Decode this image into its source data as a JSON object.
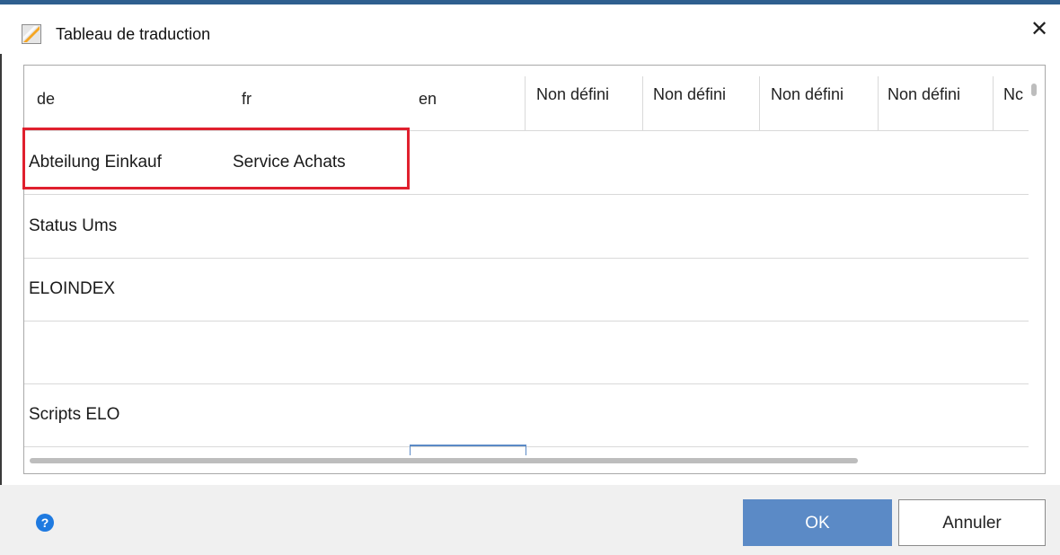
{
  "window": {
    "title": "Tableau de traduction",
    "close_glyph": "✕"
  },
  "table": {
    "columns": [
      "de",
      "fr",
      "en",
      "Non défini",
      "Non défini",
      "Non défini",
      "Non défini",
      "Nc"
    ],
    "rows": [
      [
        "Abteilung Einkauf",
        "Service Achats"
      ],
      [
        "Status Ums",
        ""
      ],
      [
        "ELOINDEX",
        ""
      ],
      [
        "",
        ""
      ],
      [
        "Scripts ELO",
        ""
      ]
    ]
  },
  "footer": {
    "help_glyph": "?",
    "ok_label": "OK",
    "cancel_label": "Annuler"
  },
  "colors": {
    "accent": "#5b8ac6",
    "highlight": "#e0202e",
    "help": "#1f7ae0"
  }
}
